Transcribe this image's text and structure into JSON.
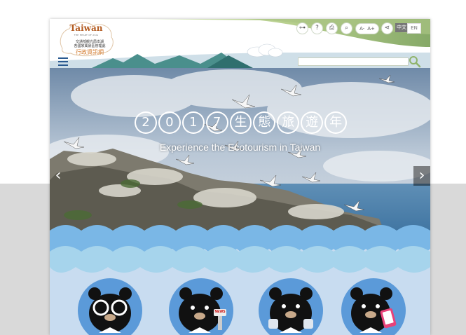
{
  "logo": {
    "title": "Taiwan",
    "subtitle": "THE HEART OF ASIA",
    "agency_line1": "交通部觀光局澎湖",
    "agency_line2": "各國家風景區管理處",
    "site_name": "行政資訊網"
  },
  "toolbar": {
    "icons": [
      "sitemap-icon",
      "help-icon",
      "print-icon",
      "zoom-icon",
      "share-icon"
    ],
    "font_smaller": "A-",
    "font_larger": "A+",
    "lang_zh": "中文",
    "lang_en": "EN"
  },
  "search": {
    "placeholder": ""
  },
  "hero": {
    "title_chars": [
      "2",
      "0",
      "1",
      "7",
      "生",
      "態",
      "旅",
      "遊",
      "年"
    ],
    "subtitle": "Experience the Ecotourism in Taiwan",
    "prev": "‹",
    "next": "›"
  },
  "mascots": {
    "items": [
      "bear-glasses",
      "bear-news",
      "bear-binoculars",
      "bear-phone"
    ],
    "news_label": "NEWS"
  },
  "colors": {
    "header_green": "#8fb36a",
    "sea": "#5a8fc0",
    "wave_light": "#a8d4ee",
    "bottom_bg": "#c8dcf0",
    "bear_circle": "#5b9ad9"
  }
}
